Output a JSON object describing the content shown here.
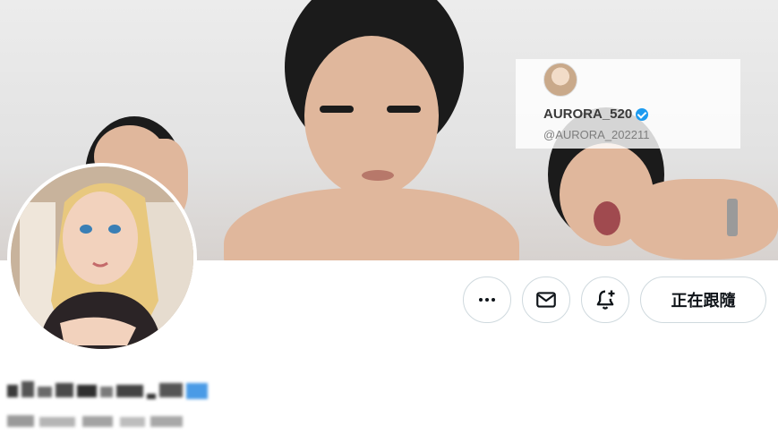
{
  "banner": {
    "overlay_card": {
      "name": "AURORA_520",
      "handle": "@AURORA_202211"
    }
  },
  "actions": {
    "more_icon": "more-icon",
    "message_icon": "mail-icon",
    "notify_icon": "bell-plus-icon",
    "follow_label": "正在跟隨"
  },
  "colors": {
    "verified": "#1d9bf0",
    "border": "#cfd9de",
    "text": "#0f1419"
  }
}
